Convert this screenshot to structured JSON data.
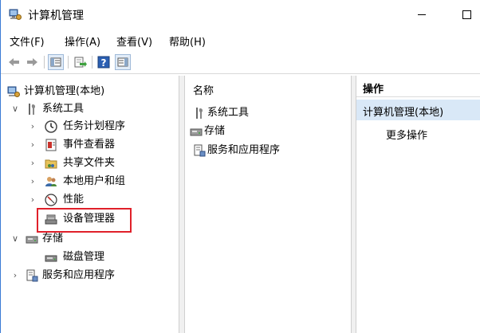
{
  "window": {
    "title": "计算机管理"
  },
  "menu": [
    "文件(F)",
    "操作(A)",
    "查看(V)",
    "帮助(H)"
  ],
  "toolbar": {
    "icons": [
      "back-arrow-icon",
      "forward-arrow-icon",
      "console-tree-icon",
      "export-list-icon",
      "help-icon",
      "action-pane-icon"
    ]
  },
  "tree": {
    "root": "计算机管理(本地)",
    "system_tools": "系统工具",
    "task_scheduler": "任务计划程序",
    "event_viewer": "事件查看器",
    "shared_folders": "共享文件夹",
    "local_users": "本地用户和组",
    "performance": "性能",
    "device_manager": "设备管理器",
    "storage": "存储",
    "disk_management": "磁盘管理",
    "services_apps": "服务和应用程序"
  },
  "middle": {
    "header": "名称",
    "items": [
      "系统工具",
      "存储",
      "服务和应用程序"
    ]
  },
  "actions": {
    "header": "操作",
    "section": "计算机管理(本地)",
    "more": "更多操作"
  },
  "colors": {
    "highlight_border": "#e0202a",
    "action_section_bg": "#d9e8f7",
    "window_border": "#3a7bd5"
  }
}
